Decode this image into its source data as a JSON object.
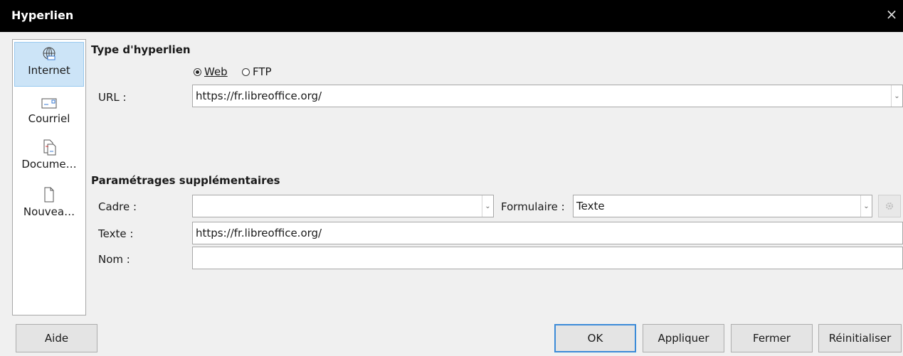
{
  "window": {
    "title": "Hyperlien",
    "close_glyph": "×"
  },
  "sidebar": {
    "items": [
      {
        "label": "Internet",
        "icon": "globe-icon",
        "selected": true
      },
      {
        "label": "Courriel",
        "icon": "envelope-icon",
        "selected": false
      },
      {
        "label": "Docume…",
        "icon": "document-icon",
        "selected": false
      },
      {
        "label": "Nouvea…",
        "icon": "new-document-icon",
        "selected": false
      }
    ]
  },
  "hyperlink_type": {
    "heading": "Type d'hyperlien",
    "radio_web": "Web",
    "radio_ftp": "FTP",
    "selected": "Web",
    "url_label": "URL :",
    "url_value": "https://fr.libreoffice.org/"
  },
  "further_settings": {
    "heading": "Paramétrages supplémentaires",
    "frame_label": "Cadre :",
    "frame_value": "",
    "form_label": "Formulaire :",
    "form_value": "Texte",
    "text_label": "Texte :",
    "text_value": "https://fr.libreoffice.org/",
    "name_label": "Nom :",
    "name_value": ""
  },
  "buttons": {
    "help": "Aide",
    "ok": "OK",
    "apply": "Appliquer",
    "close": "Fermer",
    "reset": "Réinitialiser"
  },
  "colors": {
    "titlebar": "#000000",
    "selected_bg": "#cce4f7",
    "default_button_border": "#3c8bd8"
  }
}
